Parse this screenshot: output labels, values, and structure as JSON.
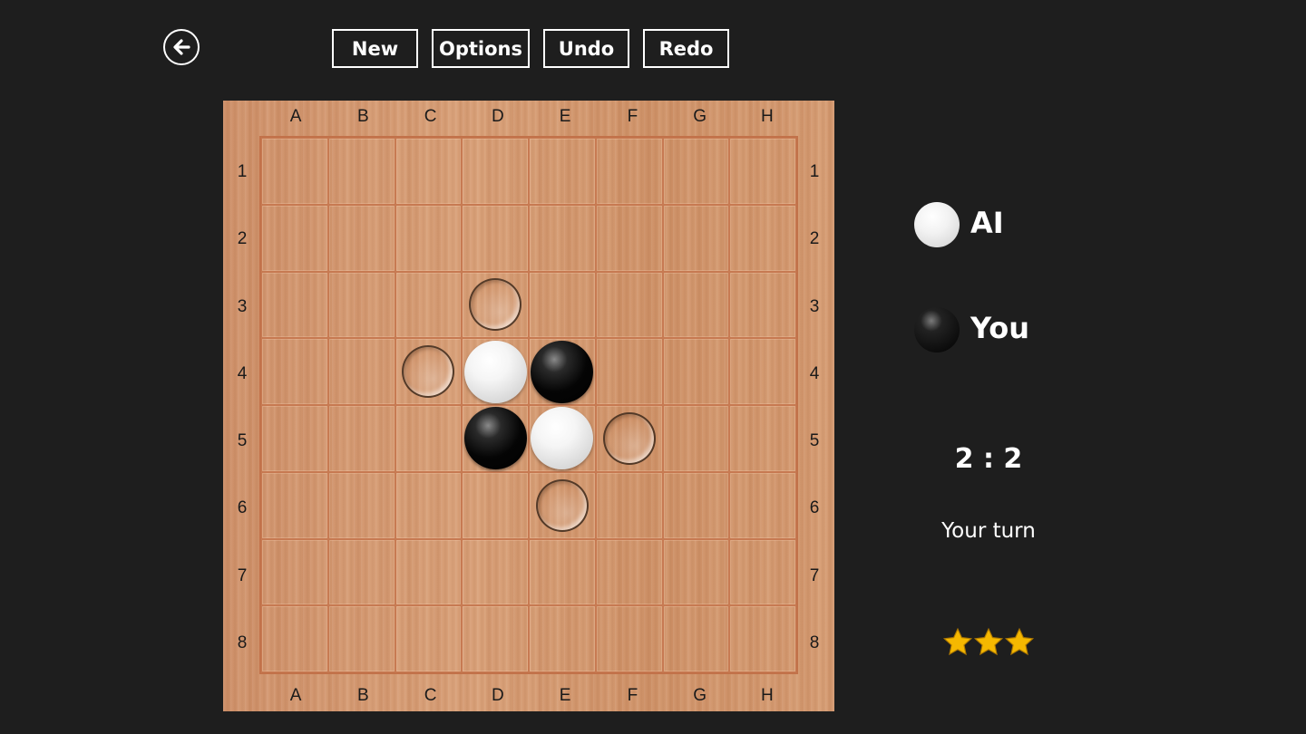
{
  "toolbar": {
    "back_icon": "back-arrow-icon",
    "buttons": [
      {
        "id": "new",
        "label": "New"
      },
      {
        "id": "options",
        "label": "Options"
      },
      {
        "id": "undo",
        "label": "Undo"
      },
      {
        "id": "redo",
        "label": "Redo"
      }
    ]
  },
  "board": {
    "columns": [
      "A",
      "B",
      "C",
      "D",
      "E",
      "F",
      "G",
      "H"
    ],
    "rows": [
      "1",
      "2",
      "3",
      "4",
      "5",
      "6",
      "7",
      "8"
    ],
    "discs": [
      {
        "cell": "D4",
        "color": "white"
      },
      {
        "cell": "E4",
        "color": "black"
      },
      {
        "cell": "D5",
        "color": "black"
      },
      {
        "cell": "E5",
        "color": "white"
      }
    ],
    "hints": [
      "D3",
      "C4",
      "F5",
      "E6"
    ]
  },
  "players": [
    {
      "name": "AI",
      "color": "white"
    },
    {
      "name": "You",
      "color": "black"
    }
  ],
  "score": "2 : 2",
  "status": "Your turn",
  "stars": 3,
  "colors": {
    "background": "#1e1e1e",
    "board": "#d2976c",
    "star": "#f5b800"
  }
}
